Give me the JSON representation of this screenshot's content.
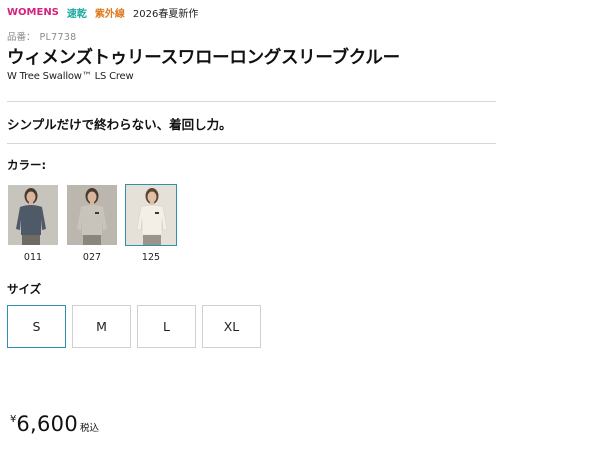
{
  "tags": [
    {
      "label": "WOMENS",
      "color": "#d6217d"
    },
    {
      "label": "速乾",
      "color": "#1aa9a0"
    },
    {
      "label": "紫外線",
      "color": "#e07a1f"
    },
    {
      "label": "2026春夏新作",
      "color": "#222222"
    }
  ],
  "product": {
    "sku_label": "品番：",
    "sku": "PL7738",
    "title": "ウィメンズトゥリースワローロングスリーブクルー",
    "subtitle": "W Tree Swallow™ LS Crew",
    "catch_copy": "シンプルだけで終わらない、着回し力。"
  },
  "color_section": {
    "label": "カラー:",
    "options": [
      {
        "code": "011",
        "shirt_color": "#4f5a68",
        "bg": "#c7c3bd",
        "selected": false
      },
      {
        "code": "027",
        "shirt_color": "#c9c4bb",
        "bg": "#bcb7ae",
        "selected": false
      },
      {
        "code": "125",
        "shirt_color": "#f3efe6",
        "bg": "#e6e1d8",
        "selected": true
      }
    ]
  },
  "size_section": {
    "label": "サイズ",
    "options": [
      {
        "label": "S",
        "selected": true
      },
      {
        "label": "M",
        "selected": false
      },
      {
        "label": "L",
        "selected": false
      },
      {
        "label": "XL",
        "selected": false
      }
    ]
  },
  "price": {
    "currency": "¥",
    "amount": "6,600",
    "tax_note": "税込"
  },
  "colors": {
    "accent": "#2f8fb0",
    "divider": "#d6d6d6"
  }
}
